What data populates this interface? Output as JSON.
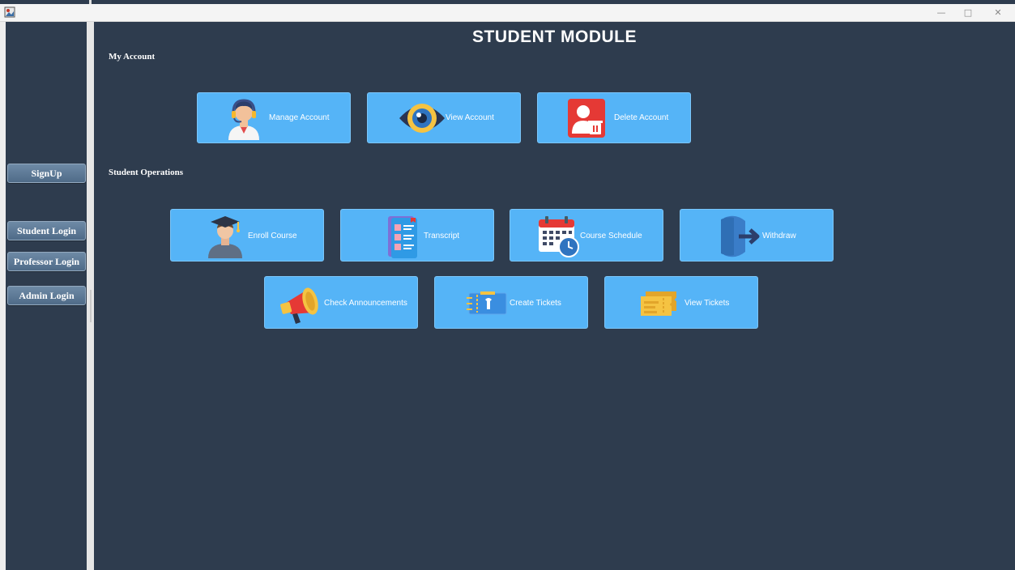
{
  "window": {
    "minimize_glyph": "—",
    "restore_glyph": "□",
    "close_glyph": "✕"
  },
  "sidebar": {
    "signup": "SignUp",
    "student_login": "Student Login",
    "professor_login": "Professor Login",
    "admin_login": "Admin Login"
  },
  "main": {
    "title": "STUDENT MODULE",
    "my_account_label": "My Account",
    "operations_label": "Student Operations",
    "account_tiles": {
      "manage": "Manage Account",
      "view": "View Account",
      "delete": "Delete Account"
    },
    "operation_tiles": {
      "enroll": "Enroll Course",
      "transcript": "Transcript",
      "schedule": "Course Schedule",
      "withdraw": "Withdraw",
      "announcements": "Check Announcements",
      "create_tickets": "Create Tickets",
      "view_tickets": "View Tickets"
    }
  },
  "colors": {
    "background": "#2e3c4e",
    "tile": "#55b4f7",
    "side_button": "#5b7694"
  }
}
